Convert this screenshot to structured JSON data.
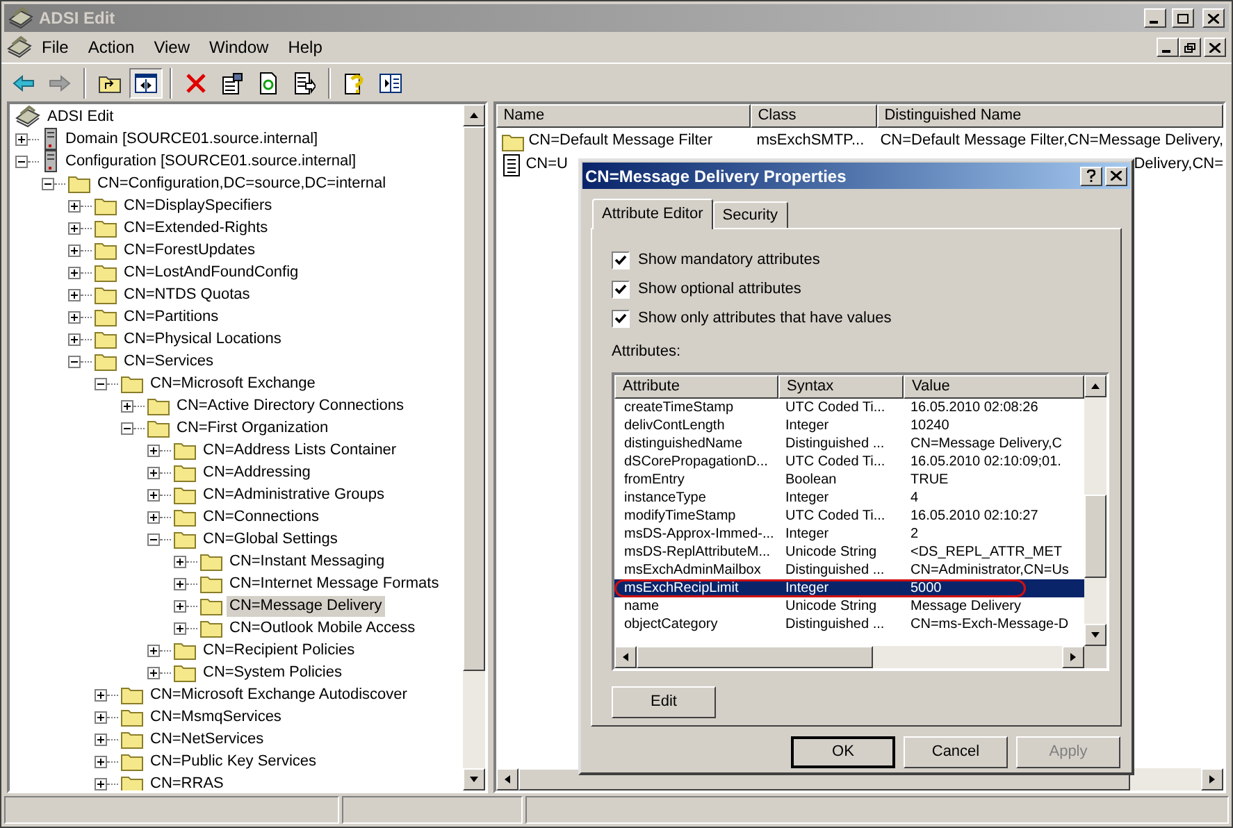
{
  "window": {
    "title": "ADSI Edit"
  },
  "menu": [
    {
      "label": "File"
    },
    {
      "label": "Action"
    },
    {
      "label": "View"
    },
    {
      "label": "Window"
    },
    {
      "label": "Help"
    }
  ],
  "toolbar": [
    {
      "kind": "back",
      "pressed": false
    },
    {
      "kind": "forward",
      "pressed": false
    },
    {
      "kind": "sep"
    },
    {
      "kind": "up",
      "pressed": false
    },
    {
      "kind": "tree",
      "pressed": true
    },
    {
      "kind": "sep"
    },
    {
      "kind": "delete",
      "pressed": false
    },
    {
      "kind": "properties",
      "pressed": false
    },
    {
      "kind": "refresh",
      "pressed": false
    },
    {
      "kind": "export",
      "pressed": false
    },
    {
      "kind": "sep"
    },
    {
      "kind": "help",
      "pressed": false
    },
    {
      "kind": "pane",
      "pressed": false
    }
  ],
  "tree": [
    {
      "label": "ADSI Edit",
      "kind": "root",
      "selected": false,
      "children": [
        {
          "label": "Domain [SOURCE01.source.internal]",
          "kind": "server",
          "expanded": false,
          "selected": false
        },
        {
          "label": "Configuration [SOURCE01.source.internal]",
          "kind": "server",
          "expanded": true,
          "selected": false,
          "children": [
            {
              "label": "CN=Configuration,DC=source,DC=internal",
              "kind": "folder",
              "expanded": true,
              "selected": false,
              "children": [
                {
                  "label": "CN=DisplaySpecifiers",
                  "kind": "folder",
                  "expanded": false,
                  "selected": false
                },
                {
                  "label": "CN=Extended-Rights",
                  "kind": "folder",
                  "expanded": false,
                  "selected": false
                },
                {
                  "label": "CN=ForestUpdates",
                  "kind": "folder",
                  "expanded": false,
                  "selected": false
                },
                {
                  "label": "CN=LostAndFoundConfig",
                  "kind": "folder",
                  "expanded": false,
                  "selected": false
                },
                {
                  "label": "CN=NTDS Quotas",
                  "kind": "folder",
                  "expanded": false,
                  "selected": false
                },
                {
                  "label": "CN=Partitions",
                  "kind": "folder",
                  "expanded": false,
                  "selected": false
                },
                {
                  "label": "CN=Physical Locations",
                  "kind": "folder",
                  "expanded": false,
                  "selected": false
                },
                {
                  "label": "CN=Services",
                  "kind": "folder",
                  "expanded": true,
                  "selected": false,
                  "children": [
                    {
                      "label": "CN=Microsoft Exchange",
                      "kind": "folder",
                      "expanded": true,
                      "selected": false,
                      "children": [
                        {
                          "label": "CN=Active Directory Connections",
                          "kind": "folder",
                          "expanded": false,
                          "selected": false
                        },
                        {
                          "label": "CN=First Organization",
                          "kind": "folder",
                          "expanded": true,
                          "selected": false,
                          "children": [
                            {
                              "label": "CN=Address Lists Container",
                              "kind": "folder",
                              "expanded": false,
                              "selected": false
                            },
                            {
                              "label": "CN=Addressing",
                              "kind": "folder",
                              "expanded": false,
                              "selected": false
                            },
                            {
                              "label": "CN=Administrative Groups",
                              "kind": "folder",
                              "expanded": false,
                              "selected": false
                            },
                            {
                              "label": "CN=Connections",
                              "kind": "folder",
                              "expanded": false,
                              "selected": false
                            },
                            {
                              "label": "CN=Global Settings",
                              "kind": "folder",
                              "expanded": true,
                              "selected": false,
                              "children": [
                                {
                                  "label": "CN=Instant Messaging",
                                  "kind": "folder",
                                  "expanded": false,
                                  "selected": false
                                },
                                {
                                  "label": "CN=Internet Message Formats",
                                  "kind": "folder",
                                  "expanded": false,
                                  "selected": false
                                },
                                {
                                  "label": "CN=Message Delivery",
                                  "kind": "folder",
                                  "expanded": false,
                                  "selected": true
                                },
                                {
                                  "label": "CN=Outlook Mobile Access",
                                  "kind": "folder",
                                  "expanded": false,
                                  "selected": false
                                }
                              ]
                            },
                            {
                              "label": "CN=Recipient Policies",
                              "kind": "folder",
                              "expanded": false,
                              "selected": false
                            },
                            {
                              "label": "CN=System Policies",
                              "kind": "folder",
                              "expanded": false,
                              "selected": false
                            }
                          ]
                        }
                      ]
                    },
                    {
                      "label": "CN=Microsoft Exchange Autodiscover",
                      "kind": "folder",
                      "expanded": false,
                      "selected": false
                    },
                    {
                      "label": "CN=MsmqServices",
                      "kind": "folder",
                      "expanded": false,
                      "selected": false
                    },
                    {
                      "label": "CN=NetServices",
                      "kind": "folder",
                      "expanded": false,
                      "selected": false
                    },
                    {
                      "label": "CN=Public Key Services",
                      "kind": "folder",
                      "expanded": false,
                      "selected": false
                    },
                    {
                      "label": "CN=RRAS",
                      "kind": "folder",
                      "expanded": false,
                      "selected": false
                    }
                  ]
                }
              ]
            }
          ]
        }
      ]
    }
  ],
  "list": {
    "columns": [
      "Name",
      "Class",
      "Distinguished Name"
    ],
    "rows": [
      {
        "kind": "folder",
        "name": "CN=Default Message Filter",
        "class": "msExchSMTP...",
        "dn": "CN=Default Message Filter,CN=Message Delivery,"
      },
      {
        "kind": "document",
        "name": "CN=U",
        "dn": "Delivery,CN="
      }
    ]
  },
  "dialog": {
    "title": "CN=Message Delivery Properties",
    "tabs": [
      {
        "label": "Attribute Editor",
        "selected": true
      },
      {
        "label": "Security",
        "selected": false
      }
    ],
    "options": [
      {
        "label": "Show mandatory attributes",
        "checked": true
      },
      {
        "label": "Show optional attributes",
        "checked": true
      },
      {
        "label": "Show only attributes that have values",
        "checked": true
      }
    ],
    "attributes_label": "Attributes:",
    "columns": [
      "Attribute",
      "Syntax",
      "Value"
    ],
    "rows": [
      {
        "attribute": "createTimeStamp",
        "syntax": "UTC Coded Ti...",
        "value": "16.05.2010 02:08:26",
        "selected": false
      },
      {
        "attribute": "delivContLength",
        "syntax": "Integer",
        "value": "10240",
        "selected": false
      },
      {
        "attribute": "distinguishedName",
        "syntax": "Distinguished ...",
        "value": "CN=Message Delivery,C",
        "selected": false
      },
      {
        "attribute": "dSCorePropagationD...",
        "syntax": "UTC Coded Ti...",
        "value": "16.05.2010 02:10:09;01.",
        "selected": false
      },
      {
        "attribute": "fromEntry",
        "syntax": "Boolean",
        "value": "TRUE",
        "selected": false
      },
      {
        "attribute": "instanceType",
        "syntax": "Integer",
        "value": "4",
        "selected": false
      },
      {
        "attribute": "modifyTimeStamp",
        "syntax": "UTC Coded Ti...",
        "value": "16.05.2010 02:10:27",
        "selected": false
      },
      {
        "attribute": "msDS-Approx-Immed-...",
        "syntax": "Integer",
        "value": "2",
        "selected": false
      },
      {
        "attribute": "msDS-ReplAttributeM...",
        "syntax": "Unicode String",
        "value": "<DS_REPL_ATTR_MET",
        "selected": false
      },
      {
        "attribute": "msExchAdminMailbox",
        "syntax": "Distinguished ...",
        "value": "CN=Administrator,CN=Us",
        "selected": false
      },
      {
        "attribute": "msExchRecipLimit",
        "syntax": "Integer",
        "value": "5000",
        "selected": true,
        "circled": true
      },
      {
        "attribute": "name",
        "syntax": "Unicode String",
        "value": "Message Delivery",
        "selected": false
      },
      {
        "attribute": "objectCategory",
        "syntax": "Distinguished ...",
        "value": "CN=ms-Exch-Message-D",
        "selected": false
      }
    ],
    "edit_button": "Edit",
    "buttons": [
      {
        "label": "OK",
        "default": true,
        "disabled": false
      },
      {
        "label": "Cancel",
        "default": false,
        "disabled": false
      },
      {
        "label": "Apply",
        "default": false,
        "disabled": true
      }
    ]
  }
}
